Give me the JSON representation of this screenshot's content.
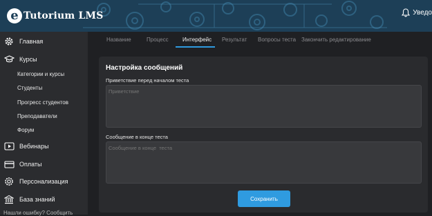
{
  "header": {
    "logo_mark": "e",
    "logo_text": "Tutorium LMS",
    "notifications_label": "Уведо"
  },
  "sidebar": {
    "items": [
      {
        "label": "Главная",
        "icon": "gear-icon"
      },
      {
        "label": "Курсы",
        "icon": "graduation-cap-icon"
      },
      {
        "label": "Вебинары",
        "icon": "video-icon"
      },
      {
        "label": "Оплаты",
        "icon": "credit-card-icon"
      },
      {
        "label": "Персонализация",
        "icon": "gear-icon"
      },
      {
        "label": "База знаний",
        "icon": "building-icon"
      }
    ],
    "courses_sub": [
      "Категории и курсы",
      "Студенты",
      "Прогресс студентов",
      "Преподаватели",
      "Форум"
    ],
    "footer_link": "Нашли ошибку? Сообщить"
  },
  "tabs": [
    "Название",
    "Процесс",
    "Интерфейс",
    "Результат",
    "Вопросы теста",
    "Закончить редактирование"
  ],
  "active_tab": "Интерфейс",
  "card": {
    "title": "Настройка сообщений",
    "fields": [
      {
        "label": "Приветствие перед началом теста",
        "placeholder": "Приветствие"
      },
      {
        "label": "Сообщение в конце теста",
        "placeholder": "Сообщение в конце  теста"
      }
    ],
    "save_label": "Сохранить"
  },
  "colors": {
    "accent": "#2f9be0",
    "header_bg": "#1d3f57",
    "sidebar_bg": "#2b2c2f",
    "page_bg": "#1f2023",
    "card_bg": "#2a2b2e"
  }
}
